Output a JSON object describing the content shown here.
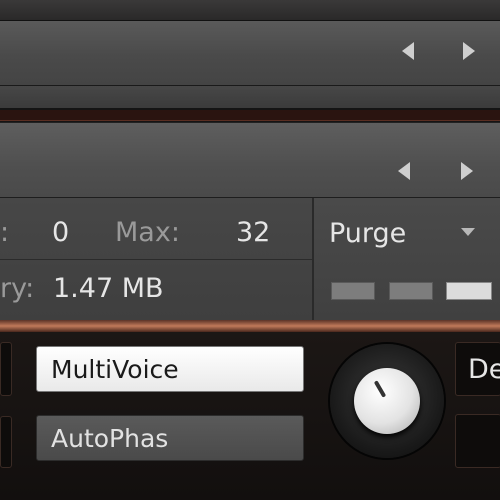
{
  "header": {
    "prev_icon": "triangle-left-icon",
    "next_icon": "triangle-right-icon"
  },
  "subheader": {
    "prev_icon": "triangle-left-icon",
    "next_icon": "triangle-right-icon"
  },
  "voices": {
    "label_partial": ":",
    "current_value": "0",
    "max_label": "Max:",
    "max_value": "32"
  },
  "memory": {
    "label_partial": "ry:",
    "value": "1.47 MB"
  },
  "purge": {
    "label": "Purge",
    "dropdown_icon": "caret-down-icon"
  },
  "instrument": {
    "multivoice_label": "MultiVoice",
    "autophase_label": "AutoPhas",
    "cutoff_label": "De",
    "knob_icon": "rotary-knob-icon"
  },
  "colors": {
    "panel_border": "#c07a5a",
    "button_on": "#ffffff",
    "button_off": "#4f4f4f"
  }
}
